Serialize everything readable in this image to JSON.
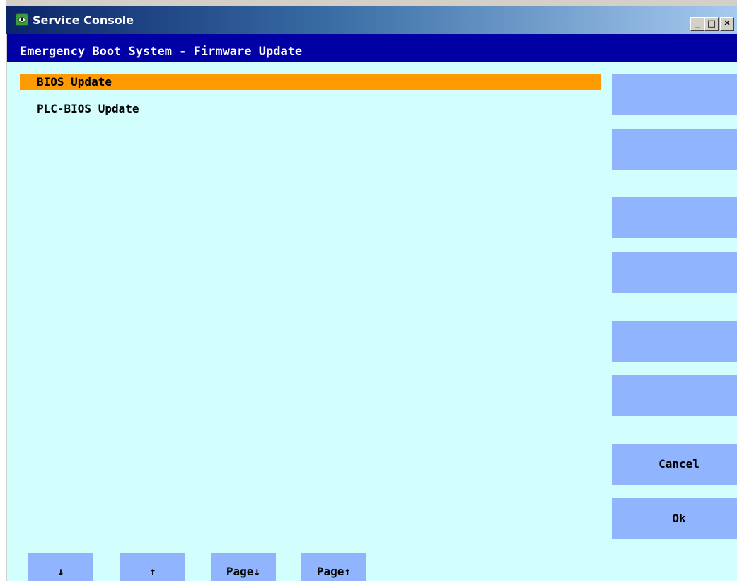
{
  "window": {
    "title": "Service Console",
    "controls": {
      "minimize": "_",
      "maximize": "□",
      "close": "✕"
    }
  },
  "header": {
    "title": "Emergency Boot System - Firmware Update"
  },
  "list": {
    "items": [
      {
        "label": "BIOS Update",
        "selected": true
      },
      {
        "label": "PLC-BIOS Update",
        "selected": false
      }
    ]
  },
  "vertical_softkeys": [
    "",
    "",
    "",
    "",
    "",
    "",
    "Cancel",
    "Ok"
  ],
  "horizontal_softkeys": [
    "↓",
    "↑",
    "Page↓",
    "Page↑"
  ],
  "colors": {
    "title_gradient_start": "#0a246a",
    "header_bg": "#0000a4",
    "content_bg": "#d2fefe",
    "selection": "#ff9a00",
    "softkey_bg": "#90b4fe"
  }
}
